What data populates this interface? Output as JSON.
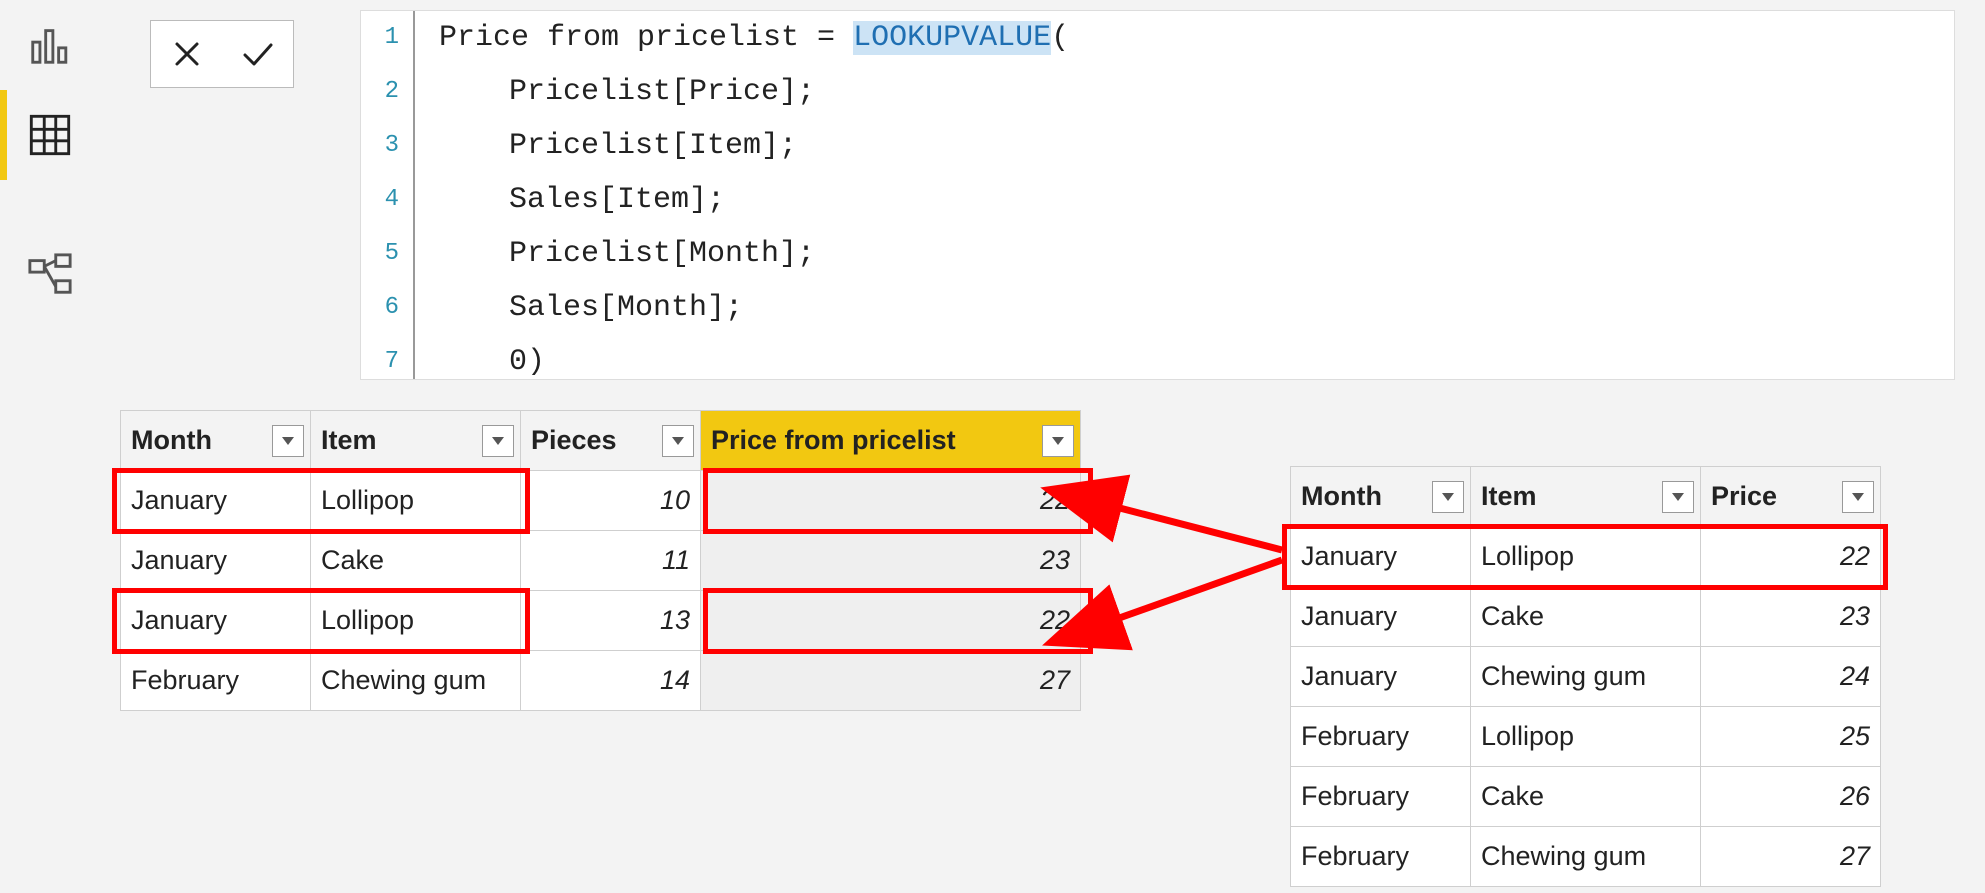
{
  "formula": {
    "lines": [
      {
        "n": "1",
        "indent": false,
        "prefix": "Price from pricelist = ",
        "funcHilite": "LOOKUPVALUE",
        "suffix": "("
      },
      {
        "n": "2",
        "indent": true,
        "prefix": "Pricelist[Price];",
        "funcHilite": "",
        "suffix": ""
      },
      {
        "n": "3",
        "indent": true,
        "prefix": "Pricelist[Item];",
        "funcHilite": "",
        "suffix": ""
      },
      {
        "n": "4",
        "indent": true,
        "prefix": "Sales[Item];",
        "funcHilite": "",
        "suffix": ""
      },
      {
        "n": "5",
        "indent": true,
        "prefix": "Pricelist[Month];",
        "funcHilite": "",
        "suffix": ""
      },
      {
        "n": "6",
        "indent": true,
        "prefix": "Sales[Month];",
        "funcHilite": "",
        "suffix": ""
      },
      {
        "n": "7",
        "indent": true,
        "prefix": "0)",
        "funcHilite": "",
        "suffix": ""
      }
    ]
  },
  "sales_table": {
    "headers": {
      "c0": "Month",
      "c1": "Item",
      "c2": "Pieces",
      "c3": "Price from pricelist"
    },
    "rows": [
      {
        "c0": "January",
        "c1": "Lollipop",
        "c2": "10",
        "c3": "22"
      },
      {
        "c0": "January",
        "c1": "Cake",
        "c2": "11",
        "c3": "23"
      },
      {
        "c0": "January",
        "c1": "Lollipop",
        "c2": "13",
        "c3": "22"
      },
      {
        "c0": "February",
        "c1": "Chewing gum",
        "c2": "14",
        "c3": "27"
      }
    ]
  },
  "pricelist_table": {
    "headers": {
      "c0": "Month",
      "c1": "Item",
      "c2": "Price"
    },
    "rows": [
      {
        "c0": "January",
        "c1": "Lollipop",
        "c2": "22"
      },
      {
        "c0": "January",
        "c1": "Cake",
        "c2": "23"
      },
      {
        "c0": "January",
        "c1": "Chewing gum",
        "c2": "24"
      },
      {
        "c0": "February",
        "c1": "Lollipop",
        "c2": "25"
      },
      {
        "c0": "February",
        "c1": "Cake",
        "c2": "26"
      },
      {
        "c0": "February",
        "c1": "Chewing gum",
        "c2": "27"
      }
    ]
  },
  "colors": {
    "accent": "#f2c811",
    "highlight_box": "#ff0000"
  }
}
